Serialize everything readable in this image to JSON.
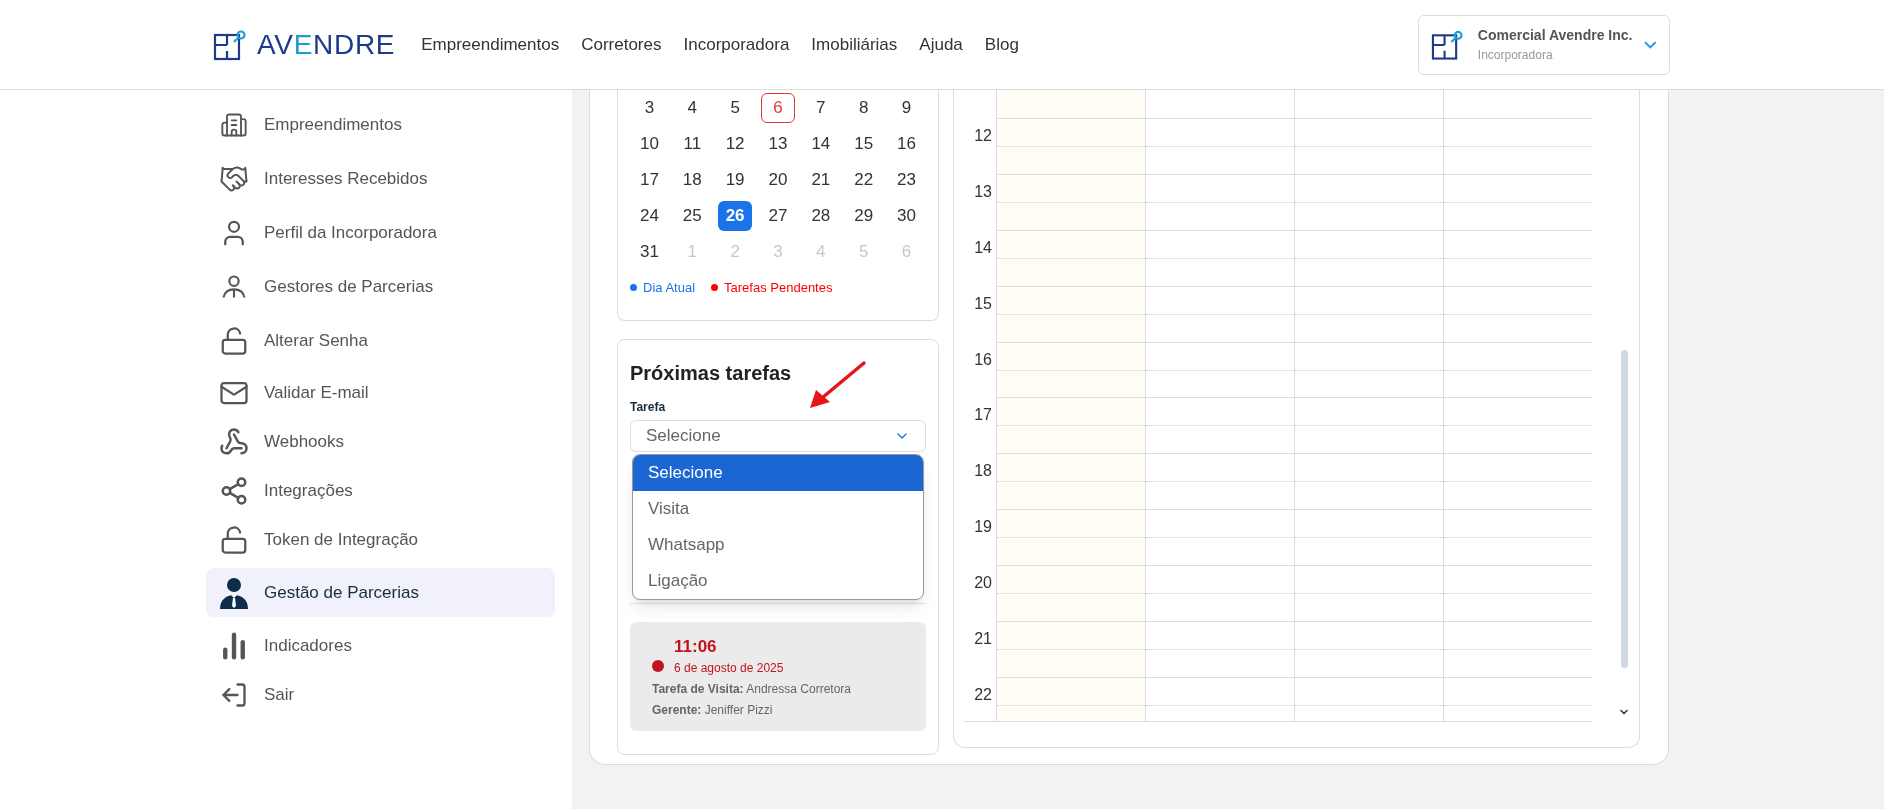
{
  "header": {
    "logo": {
      "parts": [
        {
          "text": "AV",
          "accent": false
        },
        {
          "text": "E",
          "accent": true
        },
        {
          "text": "NDRE",
          "accent": false
        }
      ]
    },
    "nav": [
      "Empreendimentos",
      "Corretores",
      "Incorporadora",
      "Imobiliárias",
      "Ajuda",
      "Blog"
    ],
    "account": {
      "name": "Comercial Avendre Inc.",
      "role": "Incorporadora"
    }
  },
  "sidebar": {
    "items": [
      {
        "label": "Empreendimentos",
        "selected": false
      },
      {
        "label": "Interesses Recebidos",
        "selected": false
      },
      {
        "label": "Perfil da Incorporadora",
        "selected": false
      },
      {
        "label": "Gestores de Parcerias",
        "selected": false
      },
      {
        "label": "Alterar Senha",
        "selected": false
      },
      {
        "label": "Validar E-mail",
        "selected": false
      },
      {
        "label": "Webhooks",
        "selected": false
      },
      {
        "label": "Integrações",
        "selected": false
      },
      {
        "label": "Token de Integração",
        "selected": false
      },
      {
        "label": "Gestão de Parcerias",
        "selected": true
      },
      {
        "label": "Indicadores",
        "selected": false
      },
      {
        "label": "Sair",
        "selected": false
      }
    ]
  },
  "calendar": {
    "weeks": [
      [
        {
          "label": "3",
          "outside": false,
          "today": false,
          "pending": false
        },
        {
          "label": "4",
          "outside": false,
          "today": false,
          "pending": false
        },
        {
          "label": "5",
          "outside": false,
          "today": false,
          "pending": false
        },
        {
          "label": "6",
          "outside": false,
          "today": false,
          "pending": true
        },
        {
          "label": "7",
          "outside": false,
          "today": false,
          "pending": false
        },
        {
          "label": "8",
          "outside": false,
          "today": false,
          "pending": false
        },
        {
          "label": "9",
          "outside": false,
          "today": false,
          "pending": false
        }
      ],
      [
        {
          "label": "10",
          "outside": false,
          "today": false,
          "pending": false
        },
        {
          "label": "11",
          "outside": false,
          "today": false,
          "pending": false
        },
        {
          "label": "12",
          "outside": false,
          "today": false,
          "pending": false
        },
        {
          "label": "13",
          "outside": false,
          "today": false,
          "pending": false
        },
        {
          "label": "14",
          "outside": false,
          "today": false,
          "pending": false
        },
        {
          "label": "15",
          "outside": false,
          "today": false,
          "pending": false
        },
        {
          "label": "16",
          "outside": false,
          "today": false,
          "pending": false
        }
      ],
      [
        {
          "label": "17",
          "outside": false,
          "today": false,
          "pending": false
        },
        {
          "label": "18",
          "outside": false,
          "today": false,
          "pending": false
        },
        {
          "label": "19",
          "outside": false,
          "today": false,
          "pending": false
        },
        {
          "label": "20",
          "outside": false,
          "today": false,
          "pending": false
        },
        {
          "label": "21",
          "outside": false,
          "today": false,
          "pending": false
        },
        {
          "label": "22",
          "outside": false,
          "today": false,
          "pending": false
        },
        {
          "label": "23",
          "outside": false,
          "today": false,
          "pending": false
        }
      ],
      [
        {
          "label": "24",
          "outside": false,
          "today": false,
          "pending": false
        },
        {
          "label": "25",
          "outside": false,
          "today": false,
          "pending": false
        },
        {
          "label": "26",
          "outside": false,
          "today": true,
          "pending": false
        },
        {
          "label": "27",
          "outside": false,
          "today": false,
          "pending": false
        },
        {
          "label": "28",
          "outside": false,
          "today": false,
          "pending": false
        },
        {
          "label": "29",
          "outside": false,
          "today": false,
          "pending": false
        },
        {
          "label": "30",
          "outside": false,
          "today": false,
          "pending": false
        }
      ],
      [
        {
          "label": "31",
          "outside": false,
          "today": false,
          "pending": false
        },
        {
          "label": "1",
          "outside": true,
          "today": false,
          "pending": false
        },
        {
          "label": "2",
          "outside": true,
          "today": false,
          "pending": false
        },
        {
          "label": "3",
          "outside": true,
          "today": false,
          "pending": false
        },
        {
          "label": "4",
          "outside": true,
          "today": false,
          "pending": false
        },
        {
          "label": "5",
          "outside": true,
          "today": false,
          "pending": false
        },
        {
          "label": "6",
          "outside": true,
          "today": false,
          "pending": false
        }
      ]
    ],
    "legend": [
      {
        "label": "Dia Atual",
        "color": "#1a73e8"
      },
      {
        "label": "Tarefas Pendentes",
        "color": "#ff0000"
      }
    ]
  },
  "tasks": {
    "title": "Próximas tarefas",
    "field_label": "Tarefa",
    "select": {
      "value": "Selecione",
      "options": [
        {
          "label": "Selecione",
          "selected": true
        },
        {
          "label": "Visita",
          "selected": false
        },
        {
          "label": "Whatsapp",
          "selected": false
        },
        {
          "label": "Ligação",
          "selected": false
        }
      ]
    },
    "items": [
      {
        "time": "11:06",
        "date": "6 de agosto de 2025",
        "lines": [
          "**Tarefa de Visita:** Andressa Corretora",
          "**Gerente:** Jeniffer Pizzi"
        ]
      }
    ]
  },
  "schedule": {
    "hours": [
      "12",
      "13",
      "14",
      "15",
      "16",
      "17",
      "18",
      "19",
      "20",
      "21",
      "22"
    ]
  }
}
